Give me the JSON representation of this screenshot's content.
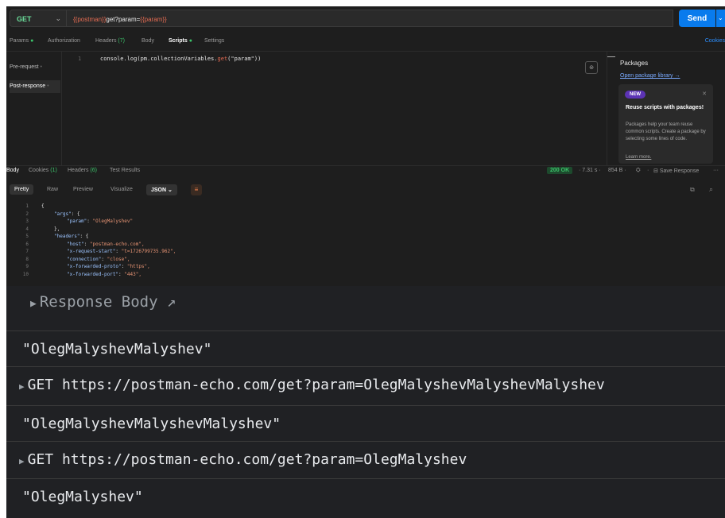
{
  "request": {
    "method": "GET",
    "url_var1": "{{postman}}",
    "url_text": "get?param=",
    "url_var2": "{{param}}",
    "send_label": "Send",
    "tabs": [
      {
        "label": "Params"
      },
      {
        "label": "Authorization"
      },
      {
        "label": "Headers",
        "count": "(7)"
      },
      {
        "label": "Body"
      },
      {
        "label": "Scripts"
      },
      {
        "label": "Settings"
      }
    ],
    "cookies_label": "Cookies",
    "script_tabs": [
      "Pre-request",
      "Post-response"
    ],
    "script_line_no": "1",
    "script_code_pre": "console.log(pm.collectionVariables.",
    "script_code_fn": "get",
    "script_code_post": "(\"param\"))"
  },
  "packages": {
    "title": "Packages",
    "open_link": "Open package library →",
    "badge": "NEW",
    "heading": "Reuse scripts with packages!",
    "body": "Packages help your team reuse common scripts. Create a package by selecting some lines of code.",
    "learn_more": "Learn more."
  },
  "response": {
    "tabs": [
      {
        "label": "Body"
      },
      {
        "label": "Cookies",
        "count": "(1)"
      },
      {
        "label": "Headers",
        "count": "(6)"
      },
      {
        "label": "Test Results"
      }
    ],
    "status": "200 OK",
    "time": "7.31 s",
    "size": "854 B",
    "save_label": "Save Response",
    "more": "···",
    "view_tabs": [
      "Pretty",
      "Raw",
      "Preview",
      "Visualize"
    ],
    "format": "JSON",
    "json_lines": [
      {
        "n": "1",
        "text": "{"
      },
      {
        "n": "2",
        "key": "\"args\"",
        "rest": ": {",
        "indent": 1
      },
      {
        "n": "3",
        "key": "\"param\"",
        "rest": ": ",
        "val": "\"OlegMalyshev\"",
        "indent": 2
      },
      {
        "n": "4",
        "text": "},",
        "indent": 1
      },
      {
        "n": "5",
        "key": "\"headers\"",
        "rest": ": {",
        "indent": 1
      },
      {
        "n": "6",
        "key": "\"host\"",
        "rest": ": ",
        "val": "\"postman-echo.com\",",
        "indent": 2
      },
      {
        "n": "7",
        "key": "\"x-request-start\"",
        "rest": ": ",
        "val": "\"t=1726799735.962\",",
        "indent": 2
      },
      {
        "n": "8",
        "key": "\"connection\"",
        "rest": ": ",
        "val": "\"close\",",
        "indent": 2
      },
      {
        "n": "9",
        "key": "\"x-forwarded-proto\"",
        "rest": ": ",
        "val": "\"https\",",
        "indent": 2
      },
      {
        "n": "10",
        "key": "\"x-forwarded-port\"",
        "rest": ": ",
        "val": "\"443\",",
        "indent": 2
      }
    ]
  },
  "console": {
    "response_body_label": "Response Body ↗",
    "lines": [
      {
        "type": "output",
        "text": "\"OlegMalyshevMalyshev\""
      },
      {
        "type": "request",
        "text": "GET https://postman-echo.com/get?param=OlegMalyshevMalyshevMalyshev"
      },
      {
        "type": "output",
        "text": "\"OlegMalyshevMalyshevMalyshev\""
      },
      {
        "type": "request",
        "text": "GET https://postman-echo.com/get?param=OlegMalyshev"
      },
      {
        "type": "output",
        "text": "\"OlegMalyshev\""
      }
    ]
  }
}
